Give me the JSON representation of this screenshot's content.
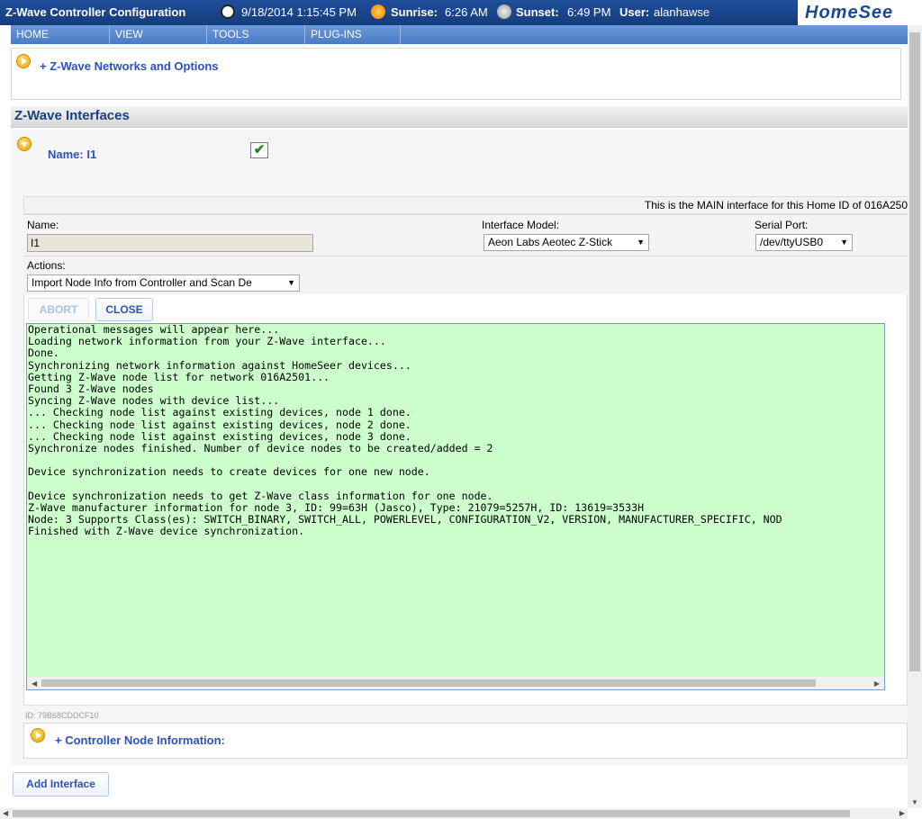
{
  "header": {
    "title": "Z-Wave Controller Configuration",
    "datetime": "9/18/2014 1:15:45 PM",
    "sunrise_label": "Sunrise:",
    "sunrise": "6:26 AM",
    "sunset_label": "Sunset:",
    "sunset": "6:49 PM",
    "user_label": "User:",
    "user": "alanhawse",
    "brand": "HomeSee"
  },
  "menu": {
    "items": [
      "HOME",
      "VIEW",
      "TOOLS",
      "PLUG-INS"
    ]
  },
  "networks_link": "+ Z-Wave Networks and Options",
  "interfaces": {
    "heading": "Z-Wave Interfaces",
    "name_label": "Name: I1",
    "enabled": true,
    "main_notice": "This is the MAIN interface for this Home ID of 016A250",
    "form": {
      "name_label": "Name:",
      "name_value": "I1",
      "model_label": "Interface Model:",
      "model_value": "Aeon Labs Aeotec Z-Stick",
      "port_label": "Serial Port:",
      "port_value": "/dev/ttyUSB0",
      "actions_label": "Actions:",
      "actions_value": "Import Node Info from Controller and Scan De"
    },
    "abort_label": "ABORT",
    "close_label": "CLOSE",
    "log_lines": [
      "Operational messages will appear here...",
      "Loading network information from your Z-Wave interface...",
      "Done.",
      "Synchronizing network information against HomeSeer devices...",
      "Getting Z-Wave node list for network 016A2501...",
      "Found 3 Z-Wave nodes",
      "Syncing Z-Wave nodes with device list...",
      "... Checking node list against existing devices, node 1 done.",
      "... Checking node list against existing devices, node 2 done.",
      "... Checking node list against existing devices, node 3 done.",
      "Synchronize nodes finished. Number of device nodes to be created/added = 2",
      "",
      "Device synchronization needs to create devices for one new node.",
      "",
      "Device synchronization needs to get Z-Wave class information for one node.",
      "Z-Wave manufacturer information for node 3, ID: 99=63H (Jasco), Type: 21079=5257H, ID: 13619=3533H",
      "Node: 3 Supports Class(es): SWITCH_BINARY, SWITCH_ALL, POWERLEVEL, CONFIGURATION_V2, VERSION, MANUFACTURER_SPECIFIC, NOD",
      "Finished with Z-Wave device synchronization."
    ],
    "id_text": "ID: 79B68CDDCF10",
    "controller_link": "+ Controller Node Information:"
  },
  "add_interface_label": "Add Interface",
  "colors": {
    "topbar": "#1f4f9a",
    "menubar": "#5687cf",
    "log_bg": "#ccffcc",
    "link": "#2a52be"
  }
}
